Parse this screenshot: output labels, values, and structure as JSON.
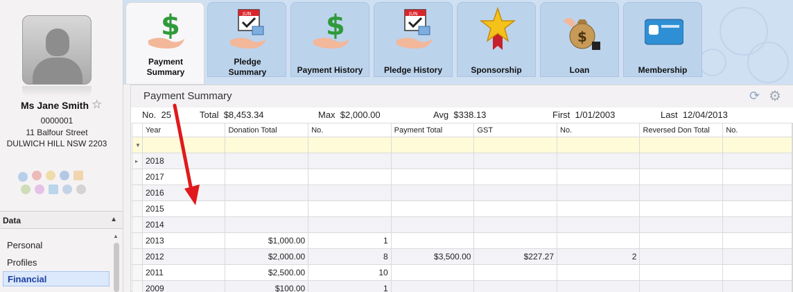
{
  "person": {
    "name": "Ms Jane Smith",
    "id": "0000001",
    "address_line1": "11 Balfour Street",
    "address_line2": "DULWICH HILL NSW 2203"
  },
  "left_nav": {
    "section_title": "Data",
    "items": [
      {
        "label": "Personal"
      },
      {
        "label": "Profiles"
      },
      {
        "label": "Financial",
        "selected": true
      }
    ]
  },
  "tabs": [
    {
      "label": "Payment Summary",
      "icon": "money-hand-icon",
      "active": true
    },
    {
      "label": "Pledge Summary",
      "icon": "pledge-calendar-icon"
    },
    {
      "label": "Payment History",
      "icon": "money-hand-icon"
    },
    {
      "label": "Pledge History",
      "icon": "pledge-calendar-icon"
    },
    {
      "label": "Sponsorship",
      "icon": "star-ribbon-icon"
    },
    {
      "label": "Loan",
      "icon": "money-bag-icon"
    },
    {
      "label": "Membership",
      "icon": "membership-card-icon"
    }
  ],
  "panel": {
    "title": "Payment Summary",
    "summary": {
      "no_label": "No.",
      "no_value": "25",
      "total_label": "Total",
      "total_value": "$8,453.34",
      "max_label": "Max",
      "max_value": "$2,000.00",
      "avg_label": "Avg",
      "avg_value": "$338.13",
      "first_label": "First",
      "first_value": "1/01/2003",
      "last_label": "Last",
      "last_value": "12/04/2013"
    },
    "columns": [
      "Year",
      "Donation Total",
      "No.",
      "Payment Total",
      "GST",
      "No.",
      "Reversed Don Total",
      "No."
    ],
    "rows": [
      [
        "2018",
        "",
        "",
        "",
        "",
        "",
        "",
        ""
      ],
      [
        "2017",
        "",
        "",
        "",
        "",
        "",
        "",
        ""
      ],
      [
        "2016",
        "",
        "",
        "",
        "",
        "",
        "",
        ""
      ],
      [
        "2015",
        "",
        "",
        "",
        "",
        "",
        "",
        ""
      ],
      [
        "2014",
        "",
        "",
        "",
        "",
        "",
        "",
        ""
      ],
      [
        "2013",
        "$1,000.00",
        "1",
        "",
        "",
        "",
        "",
        ""
      ],
      [
        "2012",
        "$2,000.00",
        "8",
        "$3,500.00",
        "$227.27",
        "2",
        "",
        ""
      ],
      [
        "2011",
        "$2,500.00",
        "10",
        "",
        "",
        "",
        "",
        ""
      ],
      [
        "2009",
        "$100.00",
        "1",
        "",
        "",
        "",
        "",
        ""
      ]
    ]
  },
  "colors": {
    "ribbon_bg": "#cfe0f2",
    "selected_nav": "#1a3fa0",
    "filter_row": "#fffbd9",
    "annotation_arrow": "#e0191c"
  }
}
